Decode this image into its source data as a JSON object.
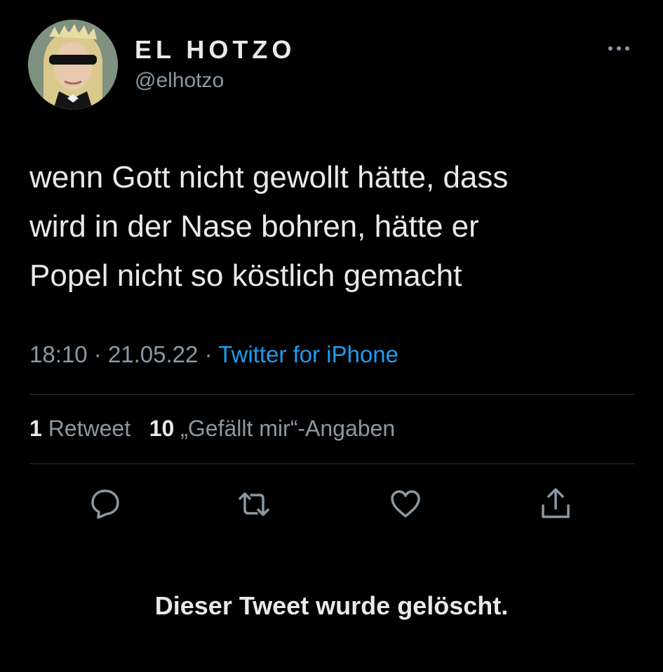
{
  "author": {
    "display_name": "EL HOTZO",
    "handle": "@elhotzo"
  },
  "tweet": {
    "text_lines": [
      "wenn Gott nicht gewollt hätte, dass",
      "wird in der Nase bohren, hätte er",
      "Popel nicht so köstlich gemacht"
    ],
    "time": "18:10",
    "separator": "·",
    "date": "21.05.22",
    "source": "Twitter for iPhone"
  },
  "stats": {
    "retweet_count": "1",
    "retweet_label": "Retweet",
    "like_count": "10",
    "like_label": "„Gefällt mir“-Angaben"
  },
  "actions": {
    "reply_icon": "reply-icon",
    "retweet_icon": "retweet-icon",
    "like_icon": "like-icon",
    "share_icon": "share-icon"
  },
  "notice": "Dieser Tweet wurde gelöscht.",
  "colors": {
    "background": "#000000",
    "text": "#e7e9ea",
    "secondary": "#8b98a5",
    "link": "#1d9bf0",
    "divider": "#2f3336"
  }
}
